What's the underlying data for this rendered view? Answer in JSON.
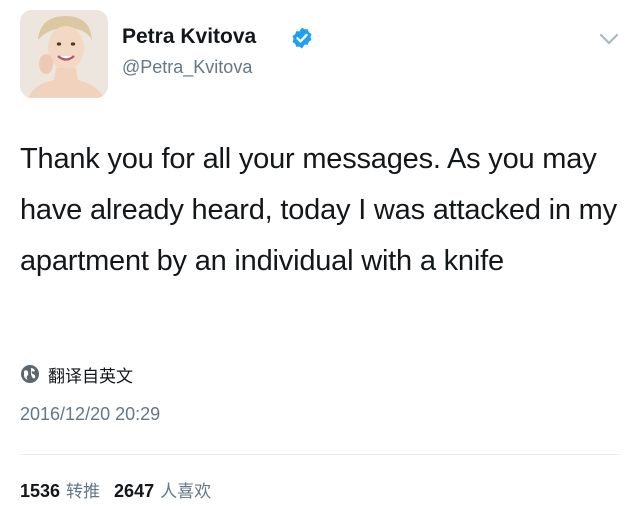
{
  "author": {
    "display_name": "Petra Kvitova",
    "handle": "@Petra_Kvitova"
  },
  "tweet": {
    "text": "Thank you for all your messages. As you may have already heard, today I was attacked in my apartment by an individual with a knife",
    "translate_label": "翻译自英文",
    "timestamp": "2016/12/20 20:29"
  },
  "stats": {
    "retweets_count": "1536",
    "retweets_label": "转推",
    "likes_count": "2647",
    "likes_label": "人喜欢"
  },
  "icons": {
    "verified": "verified-badge-icon",
    "menu": "chevron-down-icon",
    "translate": "globe-icon"
  },
  "colors": {
    "verified_blue": "#1da1f2",
    "text_primary": "#14171a",
    "text_secondary": "#657786",
    "divider": "#e6ecf0"
  }
}
